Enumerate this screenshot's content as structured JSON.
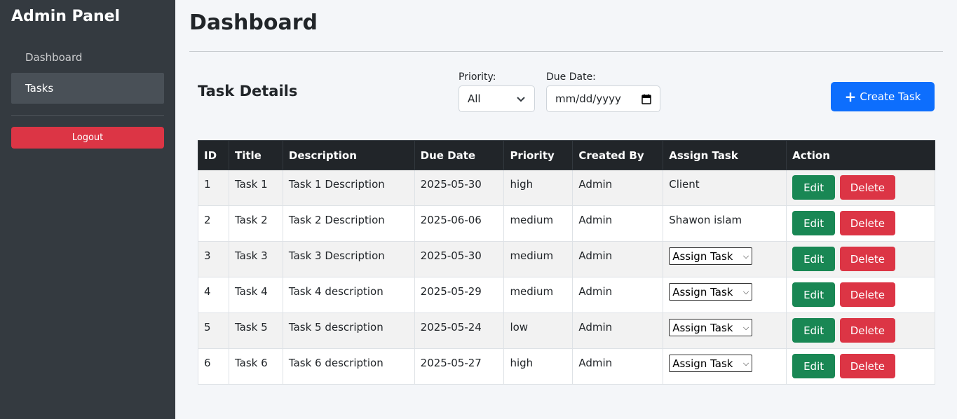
{
  "sidebar": {
    "title": "Admin Panel",
    "items": [
      {
        "label": "Dashboard",
        "active": false
      },
      {
        "label": "Tasks",
        "active": true
      }
    ],
    "logout_label": "Logout"
  },
  "header": {
    "title": "Dashboard"
  },
  "section": {
    "title": "Task Details",
    "priority_label": "Priority:",
    "priority_value": "All",
    "due_date_label": "Due Date:",
    "due_date_placeholder": "mm/dd/yyyy",
    "create_label": "Create Task"
  },
  "table": {
    "columns": [
      "ID",
      "Title",
      "Description",
      "Due Date",
      "Priority",
      "Created By",
      "Assign Task",
      "Action"
    ],
    "rows": [
      {
        "id": "1",
        "title": "Task 1",
        "description": "Task 1 Description",
        "due": "2025-05-30",
        "priority": "high",
        "created_by": "Admin",
        "assigned": "Client",
        "assign_select": false
      },
      {
        "id": "2",
        "title": "Task 2",
        "description": "Task 2 Description",
        "due": "2025-06-06",
        "priority": "medium",
        "created_by": "Admin",
        "assigned": "Shawon islam",
        "assign_select": false
      },
      {
        "id": "3",
        "title": "Task 3",
        "description": "Task 3 Description",
        "due": "2025-05-30",
        "priority": "medium",
        "created_by": "Admin",
        "assigned": "Assign Task",
        "assign_select": true
      },
      {
        "id": "4",
        "title": "Task 4",
        "description": "Task 4 description",
        "due": "2025-05-29",
        "priority": "medium",
        "created_by": "Admin",
        "assigned": "Assign Task",
        "assign_select": true
      },
      {
        "id": "5",
        "title": "Task 5",
        "description": "Task 5 description",
        "due": "2025-05-24",
        "priority": "low",
        "created_by": "Admin",
        "assigned": "Assign Task",
        "assign_select": true
      },
      {
        "id": "6",
        "title": "Task 6",
        "description": "Task 6 description",
        "due": "2025-05-27",
        "priority": "high",
        "created_by": "Admin",
        "assigned": "Assign Task",
        "assign_select": true
      }
    ],
    "edit_label": "Edit",
    "delete_label": "Delete"
  },
  "colors": {
    "sidebar_bg": "#343a40",
    "primary": "#0d6efd",
    "success": "#198754",
    "danger": "#dc3545",
    "table_header": "#212529"
  }
}
